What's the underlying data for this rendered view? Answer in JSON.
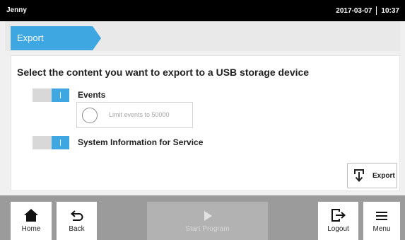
{
  "status_bar": {
    "user": "Jenny",
    "date": "2017-03-07",
    "time": "10:37"
  },
  "breadcrumb": {
    "title": "Export"
  },
  "main": {
    "heading": "Select the content you want to export to a USB storage device",
    "options": [
      {
        "label": "Events",
        "enabled": true
      },
      {
        "label": "System Information for Service",
        "enabled": true
      }
    ],
    "limit_events": {
      "label": "Limit events to 50000",
      "selected": false
    },
    "export_button": {
      "label": "Export",
      "icon": "export-icon"
    }
  },
  "bottom_bar": {
    "home": {
      "label": "Home",
      "icon": "home-icon"
    },
    "back": {
      "label": "Back",
      "icon": "back-arrow-icon"
    },
    "start_program": {
      "label": "Start Program",
      "icon": "play-icon",
      "enabled": false
    },
    "logout": {
      "label": "Logout",
      "icon": "logout-icon"
    },
    "menu": {
      "label": "Menu",
      "icon": "menu-icon"
    }
  },
  "colors": {
    "accent": "#3ea6e0",
    "status_bar": "#000000",
    "bottom_bar": "#9b9b9b"
  }
}
